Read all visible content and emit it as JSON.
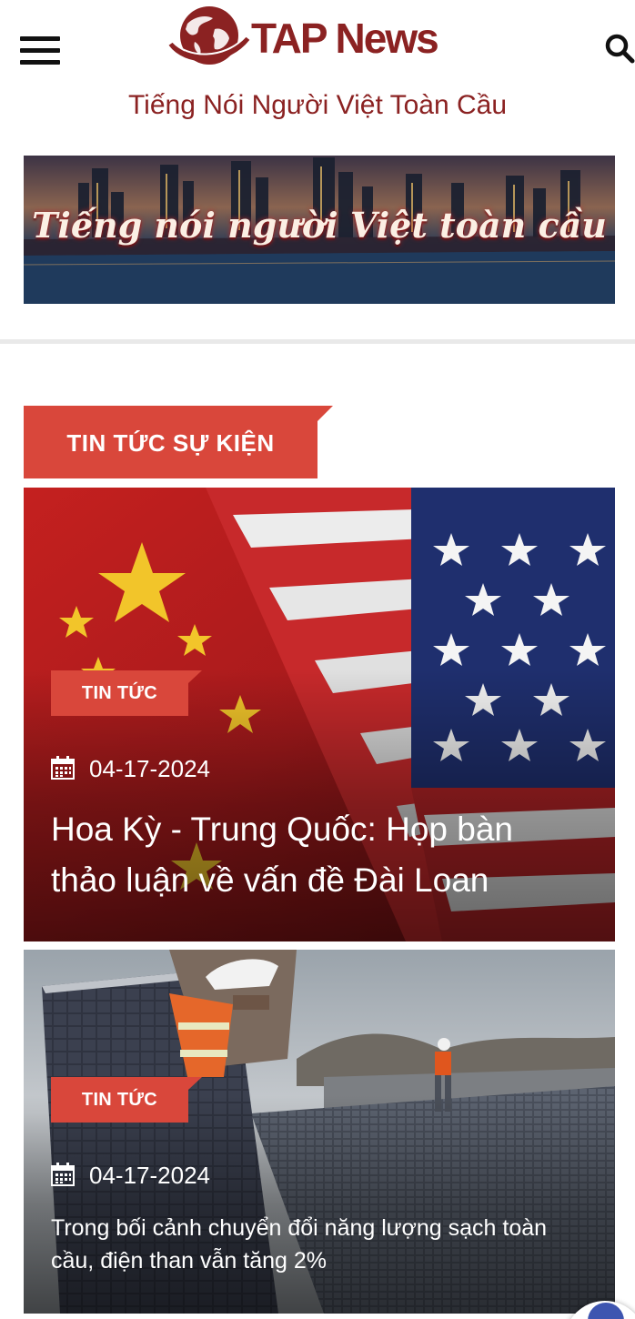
{
  "header": {
    "logo_text": "TAP News",
    "tagline": "Tiếng Nói Người Việt Toàn Cầu",
    "menu_icon": "hamburger-menu-icon",
    "search_icon": "search-icon"
  },
  "banner": {
    "text": "Tiếng nói người Việt toàn cầu"
  },
  "section": {
    "title": "TIN TỨC SỰ KIỆN"
  },
  "articles": [
    {
      "category": "TIN TỨC",
      "date": "04-17-2024",
      "title": "Hoa Kỳ - Trung Quốc: Họp bàn thảo luận về vấn đề Đài Loan",
      "image": "us-china-flags"
    },
    {
      "category": "TIN TỨC",
      "date": "04-17-2024",
      "title": "Trong bối cảnh chuyển đổi năng lượng sạch toàn cầu, điện than vẫn tăng 2%",
      "image": "solar-panel-workers"
    }
  ],
  "colors": {
    "brand": "#8b2222",
    "accent": "#d9473b"
  }
}
